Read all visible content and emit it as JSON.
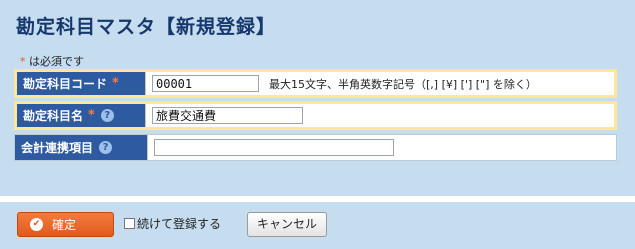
{
  "page": {
    "title": "勘定科目マスタ【新規登録】",
    "required_mark": "*",
    "required_note": "は必須です"
  },
  "form": {
    "fields": [
      {
        "label": "勘定科目コード",
        "required": "*",
        "value": "00001",
        "hint": "最大15文字、半角英数字記号（[,] [¥] ['] [\"] を除く）"
      },
      {
        "label": "勘定科目名",
        "required": "*",
        "help": "?",
        "value": "旅費交通費"
      },
      {
        "label": "会計連携項目",
        "help": "?",
        "value": ""
      }
    ]
  },
  "footer": {
    "confirm_label": "確定",
    "confirm_icon": "✔",
    "continue_label": "続けて登録する",
    "continue_checked": false,
    "cancel_label": "キャンセル"
  },
  "colors": {
    "background": "#c6dcef",
    "label_bg": "#2d5aa0",
    "highlight": "#ffe79a",
    "confirm_button": "#e25a1c",
    "title": "#17386e"
  }
}
